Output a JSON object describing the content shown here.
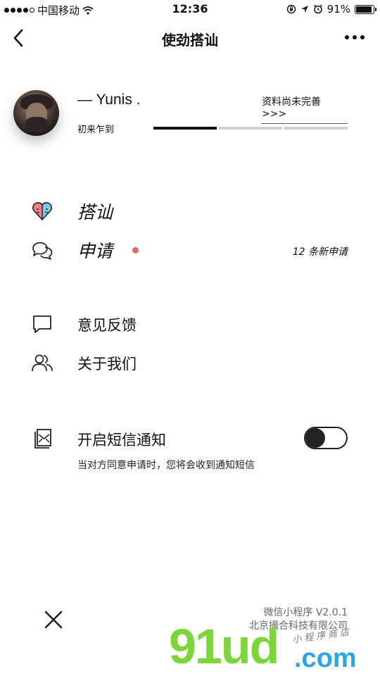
{
  "status_bar": {
    "carrier": "中国移动",
    "time": "12:36",
    "battery": "91%",
    "battery_level": 0.91
  },
  "nav": {
    "title": "使劲搭讪",
    "back_icon": "chevron-left-icon",
    "more_icon": "more-dots-icon"
  },
  "profile": {
    "username": "— Yunis .",
    "status_link": "资料尚未完善 >>>",
    "level_label": "初来乍到",
    "progress_segments_total": 3,
    "progress_segments_done": 1
  },
  "menu": {
    "chat": {
      "label": "搭讪",
      "icon": "heart-faces-icon"
    },
    "applications": {
      "label": "申请",
      "icon": "chat-bubbles-icon",
      "count_text": "12 条新申请",
      "badge_color": "#e06a6a"
    },
    "feedback": {
      "label": "意见反馈",
      "icon": "message-icon"
    },
    "about": {
      "label": "关于我们",
      "icon": "users-icon"
    },
    "sms": {
      "label": "开启短信通知",
      "icon": "sms-icon",
      "description": "当对方同意申请时，您将会收到通知短信",
      "enabled": false
    }
  },
  "footer": {
    "version": "微信小程序 V2.0.1",
    "company": "北京撮合科技有限公司",
    "close_icon": "close-icon"
  },
  "watermark": {
    "main": "91ud",
    "suffix": ".com",
    "small": "小程序商店"
  }
}
